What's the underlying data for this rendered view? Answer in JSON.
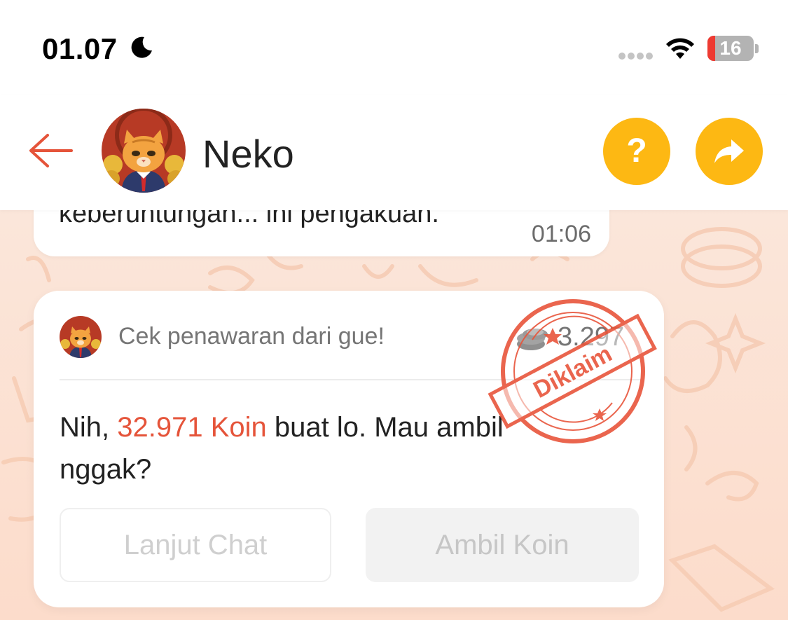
{
  "status_bar": {
    "time": "01.07",
    "battery": "16",
    "battery_level": 0.16
  },
  "header": {
    "title": "Neko"
  },
  "previous_message": {
    "text": "keberuntungan... ini pengakuan.",
    "time": "01:06"
  },
  "offer": {
    "header_text": "Cek penawaran dari gue!",
    "coin_count": "3.297",
    "message_prefix": "Nih, ",
    "message_highlight": "32.971 Koin",
    "message_suffix": " buat lo. Mau ambil nggak?",
    "stamp_text": "Diklaim",
    "continue_label": "Lanjut Chat",
    "claim_label": "Ambil Koin"
  },
  "colors": {
    "accent": "#e5543a",
    "button_yellow": "#fdb813",
    "background": "#fbe3d6"
  },
  "icons": {
    "moon": "moon-icon",
    "wifi": "wifi-icon",
    "back": "back-arrow-icon",
    "help": "question-icon",
    "share": "share-arrow-icon",
    "coin": "coin-icon"
  }
}
